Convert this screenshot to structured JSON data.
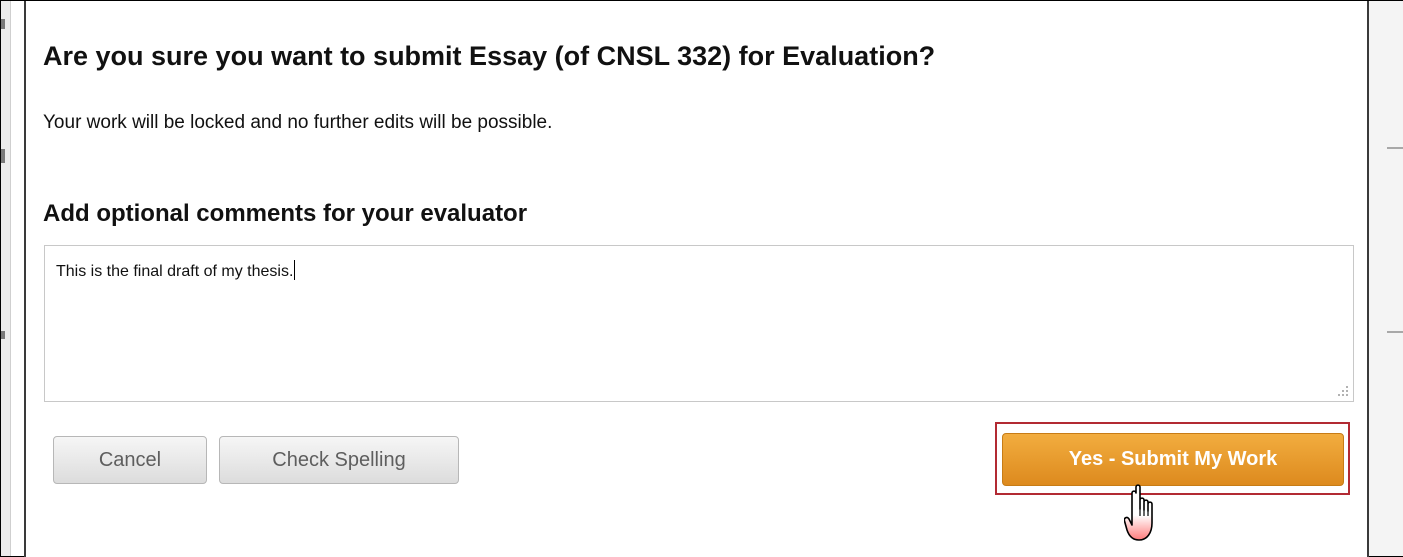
{
  "dialog": {
    "title": "Are you sure you want to submit Essay (of CNSL 332) for Evaluation?",
    "message": "Your work will be locked and no further edits will be possible.",
    "comments_heading": "Add optional comments for your evaluator",
    "comment_value": "This is the final draft of my thesis."
  },
  "buttons": {
    "cancel": "Cancel",
    "check_spelling": "Check Spelling",
    "submit": "Yes - Submit My Work"
  },
  "colors": {
    "submit_button": "#e8981f",
    "highlight_border": "#b22a33",
    "secondary_button": "#e6e6e6"
  },
  "icons": {
    "cursor": "hand-pointer-icon",
    "resize": "resize-grip-icon"
  }
}
